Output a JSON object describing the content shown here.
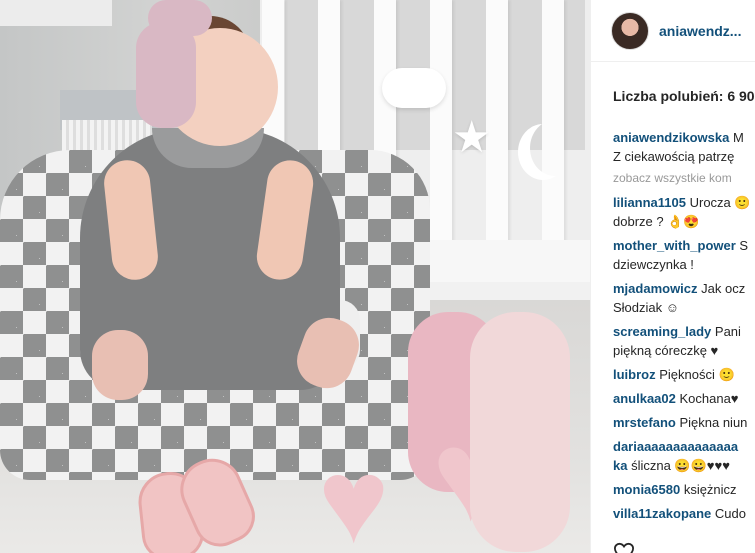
{
  "post": {
    "username": "aniawendz...",
    "likes_text": "Liczba polubień: 6 90",
    "view_all_comments": "zobacz wszystkie kom",
    "comments": [
      {
        "user": "aniawendzikowska",
        "text": " M",
        "text2": "Z ciekawością patrzę"
      },
      {
        "user": "lilianna1105",
        "text": " Urocza 🙂",
        "text2": "dobrze ? 👌😍"
      },
      {
        "user": "mother_with_power",
        "text": " S",
        "text2": "dziewczynka !"
      },
      {
        "user": "mjadamowicz",
        "text": " Jak ocz",
        "text2": "Słodziak ☺"
      },
      {
        "user": "screaming_lady",
        "text": " Pani",
        "text2": "piękną córeczkę ♥"
      },
      {
        "user": "luibroz",
        "text": " Piękności 🙂",
        "text2": ""
      },
      {
        "user": "anulkaa02",
        "text": " Kochana♥",
        "text2": ""
      },
      {
        "user": "mrstefano",
        "text": " Piękna niun",
        "text2": ""
      },
      {
        "user": "dariaaaaaaaaaaaaaa",
        "text": "",
        "user2": "ka",
        "text2": " śliczna 😀😀♥♥♥"
      },
      {
        "user": "monia6580",
        "text": " księżnicz",
        "text2": ""
      },
      {
        "user": "villa11zakopane",
        "text": " Cudo",
        "text2": ""
      }
    ]
  },
  "icons": {
    "like": "heart-outline-icon"
  }
}
